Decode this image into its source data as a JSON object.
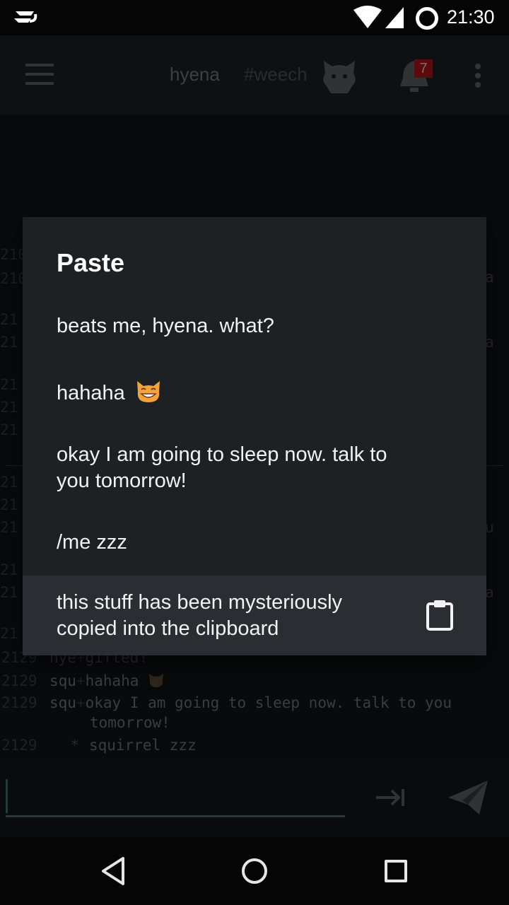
{
  "status_bar": {
    "time": "21:30",
    "logo_icon": "weechat-logo-icon",
    "wifi_icon": "wifi-icon",
    "signal_icon": "signal-icon",
    "sync_icon": "sync-circle-icon"
  },
  "toolbar": {
    "menu_icon": "hamburger-menu-icon",
    "tabs": [
      {
        "label": "hyena"
      },
      {
        "label": "#weechat"
      }
    ],
    "cat_icon": "cat-avatar-icon",
    "notifications": {
      "icon": "bell-icon",
      "count": "7"
    },
    "overflow_icon": "more-vert-icon"
  },
  "chat": {
    "gutter_rows": [
      {
        "text": "210"
      },
      {
        "text": "210"
      },
      {
        "text": "21"
      },
      {
        "text": "21"
      },
      {
        "text": "21"
      },
      {
        "text": "21"
      },
      {
        "text": "21"
      },
      {
        "text": "21"
      },
      {
        "text": "21"
      },
      {
        "text": "21"
      },
      {
        "text": "21"
      },
      {
        "text": "21"
      },
      {
        "text": "21"
      }
    ],
    "edge_chars": [
      {
        "text": "a"
      },
      {
        "text": "a"
      },
      {
        "text": "u"
      },
      {
        "text": "a"
      }
    ],
    "lines": [
      {
        "ts": "2129",
        "nick": "hye",
        "sep": "+",
        "msg": "gifted!"
      },
      {
        "ts": "2129",
        "nick": "squ",
        "sep": "+",
        "msg": "hahaha"
      },
      {
        "ts": "2129",
        "nick": "squ",
        "sep": "+",
        "msg": "okay I am going to sleep now. talk to you"
      }
    ],
    "continuation": "tomorrow!",
    "action": {
      "ts": "2129",
      "star": "*",
      "msg": "squirrel zzz"
    }
  },
  "input": {
    "value": "",
    "placeholder": "",
    "tab_icon": "tab-key-icon",
    "send_icon": "send-icon"
  },
  "nav": {
    "back_icon": "back-triangle-icon",
    "home_icon": "home-circle-icon",
    "recents_icon": "recents-square-icon"
  },
  "dialog": {
    "title": "Paste",
    "items": [
      {
        "text": "beats me, hyena. what?"
      },
      {
        "text": "hahaha"
      },
      {
        "text": "okay I am going to sleep now. talk to you tomorrow!"
      },
      {
        "text": "/me zzz"
      },
      {
        "text": "this stuff has been mysteriously copied into the clipboard"
      }
    ],
    "clipboard_icon": "clipboard-icon",
    "emoji_icon": "grinning-cat-emoji-icon"
  }
}
